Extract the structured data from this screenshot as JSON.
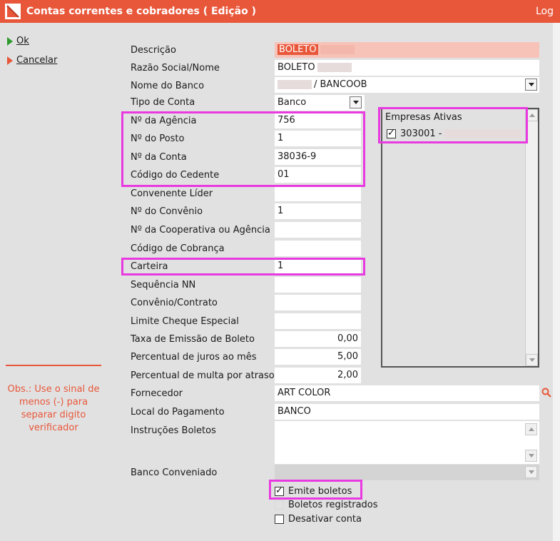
{
  "window": {
    "title": "Contas correntes e cobradores ( Edição )",
    "log_label": "Log"
  },
  "sidebar": {
    "ok_label": "Ok",
    "cancel_label": "Cancelar",
    "note": "Obs.: Use o sinal de menos (-) para separar digito verificador"
  },
  "form": {
    "descricao_label": "Descrição",
    "descricao_value": "BOLETO",
    "razao_label": "Razão Social/Nome",
    "razao_value": "BOLETO",
    "banco_label": "Nome do Banco",
    "banco_value": "/ BANCOOB",
    "tipo_label": "Tipo de Conta",
    "tipo_value": "Banco",
    "agencia_label": "Nº da Agência",
    "agencia_value": "756",
    "posto_label": "Nº do Posto",
    "posto_value": "1",
    "conta_label": "Nº da Conta",
    "conta_value": "38036-9",
    "cedente_label": "Código do Cedente",
    "cedente_value": "01",
    "convenente_label": "Convenente Líder",
    "convenente_value": "",
    "convenio_label": "Nº do Convênio",
    "convenio_value": "1",
    "cooperativa_label": "Nº da Cooperativa ou Agência",
    "cooperativa_value": "",
    "cobranca_label": "Código de Cobrança",
    "cobranca_value": "",
    "carteira_label": "Carteira",
    "carteira_value": "1",
    "sequencia_label": "Sequência NN",
    "sequencia_value": "",
    "contrato_label": "Convênio/Contrato",
    "contrato_value": "",
    "limite_label": "Limite Cheque Especial",
    "limite_value": "",
    "taxa_label": "Taxa de Emissão de Boleto",
    "taxa_value": "0,00",
    "juros_label": "Percentual de juros ao mês",
    "juros_value": "5,00",
    "multa_label": "Percentual de multa por atraso",
    "multa_value": "2,00",
    "fornecedor_label": "Fornecedor",
    "fornecedor_value": "ART COLOR",
    "local_label": "Local do Pagamento",
    "local_value": "BANCO",
    "instrucoes_label": "Instruções Boletos",
    "instrucoes_value": "",
    "conveniado_label": "Banco Conveniado",
    "conveniado_value": ""
  },
  "empresas": {
    "header": "Empresas Ativas",
    "item_label": "303001 -"
  },
  "checks": {
    "emite_label": "Emite boletos",
    "registrados_label": "Boletos registrados",
    "desativar_label": "Desativar conta"
  },
  "colors": {
    "accent": "#e8573a",
    "highlight": "#e83ae0",
    "background": "#e1e1e1"
  }
}
